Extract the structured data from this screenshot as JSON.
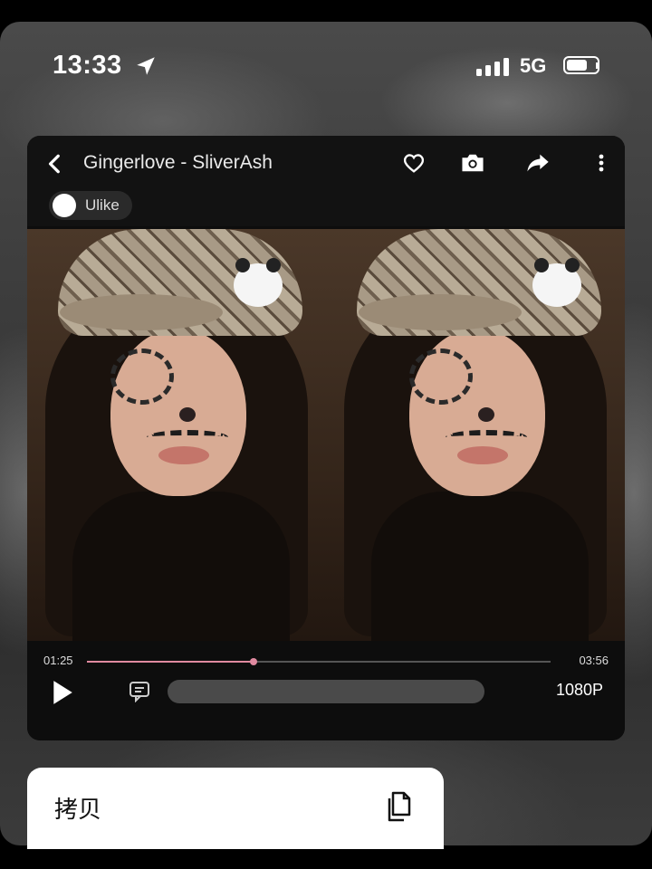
{
  "status_bar": {
    "time": "13:33",
    "network": "5G",
    "icons": [
      "location-arrow-icon",
      "signal-icon",
      "battery-icon"
    ]
  },
  "player": {
    "title": "Gingerlove - SliverAsh",
    "user": "Ulike",
    "toolbar_icons": [
      "back-icon",
      "heart-icon",
      "camera-icon",
      "share-icon",
      "more-icon"
    ],
    "current_time": "01:25",
    "duration": "03:56",
    "progress": 0.36,
    "quality": "1080P",
    "danmu_icon": "danmu-icon",
    "play_icon": "play-icon"
  },
  "context_menu": {
    "copy_label": "拷贝",
    "copy_icon": "copy-icon"
  },
  "colors": {
    "accent": "#e08aa0",
    "player_bg": "#0d0d0d"
  }
}
